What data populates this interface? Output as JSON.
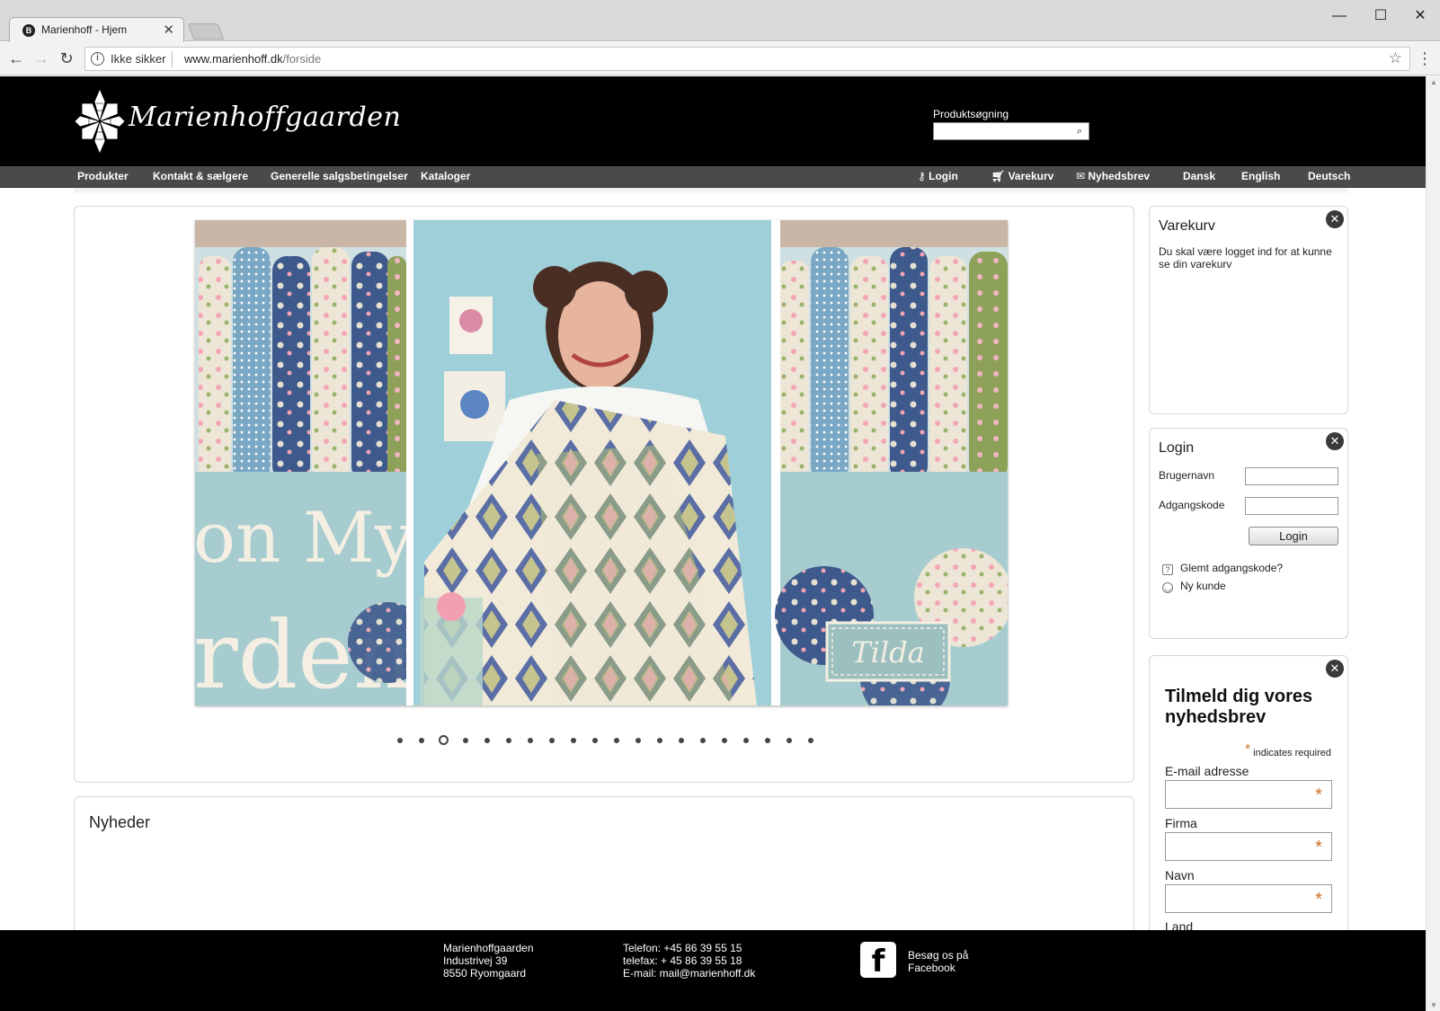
{
  "browser": {
    "tab_title": "Marienhoff - Hjem",
    "tab_favicon": "B",
    "security_label": "Ikke sikker",
    "url_host": "www.marienhoff.dk",
    "url_path": "/forside"
  },
  "header": {
    "logo_text": "Marienhoffgaarden",
    "search_label": "Produktsøgning",
    "search_value": ""
  },
  "nav": {
    "left": [
      "Produkter",
      "Kontakt & sælgere",
      "Generelle salgsbetingelser",
      "Kataloger"
    ],
    "login": "Login",
    "cart": "Varekurv",
    "newsletter": "Nyhedsbrev",
    "languages": [
      "Dansk",
      "English",
      "Deutsch"
    ]
  },
  "slider": {
    "image_text_top": "on My",
    "image_text_bottom": "rden",
    "badge": "Tilda",
    "dot_count": 20,
    "active_dot": 3
  },
  "news": {
    "title": "Nyheder"
  },
  "cart_panel": {
    "title": "Varekurv",
    "text": "Du skal være logget ind for at kunne se din varekurv"
  },
  "login_panel": {
    "title": "Login",
    "username_label": "Brugernavn",
    "password_label": "Adgangskode",
    "button": "Login",
    "forgot": "Glemt adgangskode?",
    "new_customer": "Ny kunde"
  },
  "newsletter_panel": {
    "title": "Tilmeld dig vores nyhedsbrev",
    "required_note": "indicates required",
    "fields": [
      "E-mail adresse",
      "Firma",
      "Navn",
      "Land"
    ]
  },
  "footer": {
    "address": [
      "Marienhoffgaarden",
      "Industrivej 39",
      "8550 Ryomgaard"
    ],
    "contact": [
      "Telefon: +45 86 39 55 15",
      "telefax: + 45 86 39 55 18",
      "E-mail: mail@marienhoff.dk"
    ],
    "facebook": [
      "Besøg os på",
      "Facebook"
    ]
  },
  "colors": {
    "header_bg": "#000000",
    "nav_bg": "#4a4a4a",
    "accent_star": "#c9712a"
  }
}
